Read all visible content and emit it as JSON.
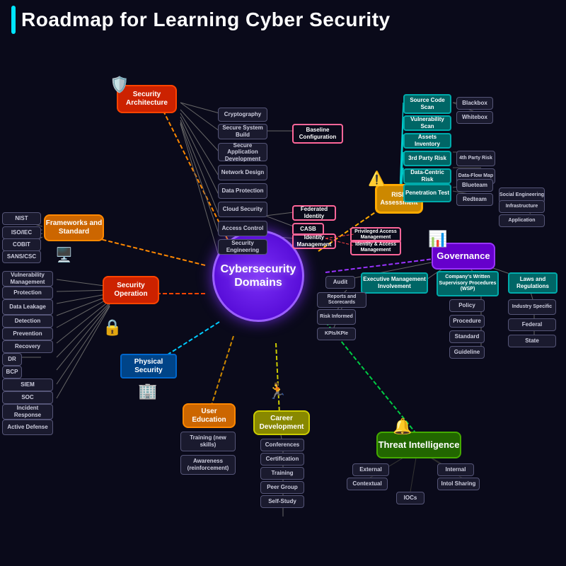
{
  "title": "Roadmap for Learning Cyber Security",
  "nodes": {
    "central": {
      "label": "Cybersecurity\nDomains"
    },
    "security_architecture": {
      "label": "Security\nArchitecture"
    },
    "frameworks": {
      "label": "Frameworks\nand Standard"
    },
    "security_operation": {
      "label": "Security\nOperation"
    },
    "physical_security": {
      "label": "Physical\nSecurity"
    },
    "user_education": {
      "label": "User\nEducation"
    },
    "career_development": {
      "label": "Career\nDevelopment"
    },
    "threat_intelligence": {
      "label": "Threat\nIntelligence"
    },
    "governance": {
      "label": "Governance"
    },
    "risk_assessment": {
      "label": "RISK\nAssessment"
    },
    "cryptography": {
      "label": "Cryptography"
    },
    "secure_system": {
      "label": "Secure System\nBuild"
    },
    "secure_app": {
      "label": "Secure Application\nDevelopment"
    },
    "network_design": {
      "label": "Network\nDesign"
    },
    "data_protection": {
      "label": "Data\nProtection"
    },
    "cloud_security": {
      "label": "Cloud\nSecurity"
    },
    "access_control": {
      "label": "Access\nControl"
    },
    "security_engineering": {
      "label": "Security\nEngineering"
    },
    "baseline_config": {
      "label": "Baseline\nConfiguration"
    },
    "federated_identity": {
      "label": "Federated\nIdentity"
    },
    "casb": {
      "label": "CASB"
    },
    "identity_management": {
      "label": "Identity\nManagement"
    },
    "privileged_access": {
      "label": "Privileged Access\nManagement"
    },
    "identity_access": {
      "label": "Identity & Access\nManagement"
    },
    "nist": {
      "label": "NIST"
    },
    "iso_iec": {
      "label": "ISO/IEC"
    },
    "cobit": {
      "label": "COBIT"
    },
    "sans_csc": {
      "label": "SANS/CSC"
    },
    "vulnerability_mgmt": {
      "label": "Vulnerability\nManagement"
    },
    "protection": {
      "label": "Protection"
    },
    "data_leakage": {
      "label": "Data\nLeakage"
    },
    "detection": {
      "label": "Detection"
    },
    "prevention": {
      "label": "Prevention"
    },
    "recovery": {
      "label": "Recovery"
    },
    "dr": {
      "label": "DR"
    },
    "bcp": {
      "label": "BCP"
    },
    "siem": {
      "label": "SIEM"
    },
    "soc": {
      "label": "SOC"
    },
    "incident_response": {
      "label": "Incident\nResponse"
    },
    "active_defense": {
      "label": "Active Defense"
    },
    "training": {
      "label": "Training\n(new skills)"
    },
    "awareness": {
      "label": "Awareness\n(reinforcement)"
    },
    "conferences": {
      "label": "Conferences"
    },
    "certification": {
      "label": "Certification"
    },
    "training_career": {
      "label": "Training"
    },
    "peer_group": {
      "label": "Peer Group"
    },
    "self_study": {
      "label": "Self-Study"
    },
    "external": {
      "label": "External"
    },
    "internal": {
      "label": "Internal"
    },
    "contextual": {
      "label": "Contextual"
    },
    "intol_sharing": {
      "label": "Intol Sharing"
    },
    "iocs": {
      "label": "IOCs"
    },
    "audit": {
      "label": "Audit"
    },
    "exec_mgmt": {
      "label": "Executive Management\nInvolvement"
    },
    "company_procedures": {
      "label": "Company's\nWritten Supervisory\nProcedures (WSP)"
    },
    "laws_regulations": {
      "label": "Laws and\nRegulations"
    },
    "reports_scorecards": {
      "label": "Reports and\nScorecards"
    },
    "risk_informed": {
      "label": "Risk\nInformed"
    },
    "kpis": {
      "label": "KPIs/KPIe"
    },
    "policy": {
      "label": "Policy"
    },
    "procedure": {
      "label": "Procedure"
    },
    "standard": {
      "label": "Standard"
    },
    "guideline": {
      "label": "Guideline"
    },
    "industry_specific": {
      "label": "Industry\nSpecific"
    },
    "federal": {
      "label": "Federal"
    },
    "state": {
      "label": "State"
    },
    "source_code_scan": {
      "label": "Source Code\nScan"
    },
    "vulnerability_scan": {
      "label": "Vulnerability\nScan"
    },
    "assets_inventory": {
      "label": "Assets\nInventory"
    },
    "third_party_risk": {
      "label": "3rd Party Risk"
    },
    "fourth_party_risk": {
      "label": "4th Party\nRisk"
    },
    "data_centric_risk": {
      "label": "Data-Centric Risk"
    },
    "data_flow_map": {
      "label": "Data-Flow\nMap"
    },
    "penetration_test": {
      "label": "Penetration\nTest"
    },
    "blueteam": {
      "label": "Blueteam"
    },
    "redteam": {
      "label": "Redteam"
    },
    "blackbox": {
      "label": "Blackbox"
    },
    "whitebox": {
      "label": "Whitebox"
    },
    "social_engineering": {
      "label": "Social\nEngineering"
    },
    "infrastructure": {
      "label": "Infrastructure"
    },
    "application": {
      "label": "Application"
    }
  }
}
